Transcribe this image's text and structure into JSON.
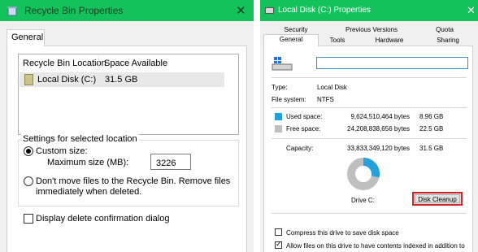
{
  "left_dialog": {
    "title": "Recycle Bin Properties",
    "close_glyph": "✕",
    "tab_general": "General",
    "list": {
      "col_location": "Recycle Bin Location",
      "col_space": "Space Available",
      "rows": [
        {
          "location": "Local Disk (C:)",
          "space": "31.5 GB"
        }
      ]
    },
    "settings": {
      "legend": "Settings for selected location",
      "custom_size_label": "Custom size:",
      "max_size_label": "Maximum size (MB):",
      "max_size_value": "3226",
      "dont_move_line1": "Don't move files to the Recycle Bin. Remove files",
      "dont_move_line2": "immediately when deleted.",
      "custom_selected": true
    },
    "confirm_label": "Display delete confirmation dialog",
    "confirm_checked": false
  },
  "right_dialog": {
    "title": "Local Disk (C:) Properties",
    "close_glyph": "✕",
    "tabs_row1": [
      "Security",
      "Previous Versions",
      "Quota"
    ],
    "tabs_row2": [
      "General",
      "Tools",
      "Hardware",
      "Sharing"
    ],
    "active_tab": "General",
    "name_value": "",
    "type_label": "Type:",
    "type_value": "Local Disk",
    "fs_label": "File system:",
    "fs_value": "NTFS",
    "used_label": "Used space:",
    "used_bytes": "9,624,510,464 bytes",
    "used_gb": "8.96 GB",
    "free_label": "Free space:",
    "free_bytes": "24,208,838,656 bytes",
    "free_gb": "22.5 GB",
    "capacity_label": "Capacity:",
    "capacity_bytes": "33,833,349,120 bytes",
    "capacity_gb": "31.5 GB",
    "used_fraction": 0.2845,
    "drive_label": "Drive C:",
    "cleanup_label": "Disk Cleanup",
    "compress_label": "Compress this drive to save disk space",
    "compress_checked": false,
    "index_label": "Allow files on this drive to have contents indexed in addition to",
    "index_checked": true,
    "colors": {
      "used": "#26a0da",
      "free": "#bfbfbf",
      "titlebar": "#13c25a",
      "highlight": "#d0252a"
    }
  }
}
